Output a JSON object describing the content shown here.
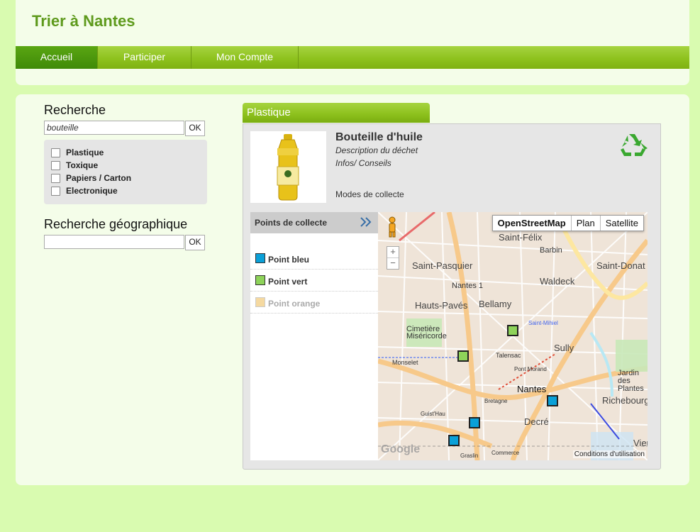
{
  "header": {
    "title": "Trier à Nantes",
    "nav": [
      "Accueil",
      "Participer",
      "Mon Compte"
    ]
  },
  "search": {
    "heading": "Recherche",
    "value": "bouteille",
    "ok_label": "OK",
    "filters": [
      "Plastique",
      "Toxique",
      "Papiers / Carton",
      "Electronique"
    ]
  },
  "geo_search": {
    "heading": "Recherche géographique",
    "value": "",
    "ok_label": "OK"
  },
  "category": {
    "label": "Plastique"
  },
  "product": {
    "title": "Bouteille d'huile",
    "description": "Description du déchet",
    "tips": "Infos/ Conseils",
    "modes": "Modes de collecte"
  },
  "points": {
    "header": "Points de collecte",
    "items": [
      {
        "label": "Point bleu",
        "color": "#0aa0d8"
      },
      {
        "label": "Point vert",
        "color": "#8ed35a"
      },
      {
        "label": "Point orange",
        "color": "#f5d9a0"
      }
    ]
  },
  "map": {
    "types": [
      "OpenStreetMap",
      "Plan",
      "Satellite"
    ],
    "zoom_in": "+",
    "zoom_out": "−",
    "terms": "Conditions d'utilisation",
    "logo": "Google",
    "labels": [
      "Saint-Félix",
      "Barbin",
      "Saint-Pasquier",
      "Saint-Donat",
      "Nantes 1",
      "Waldeck",
      "Hauts-Pavés",
      "Bellamy",
      "Cimetière Miséricorde",
      "Saint-Mihiel",
      "Sully",
      "Talensac",
      "Monselet",
      "Pont Morand",
      "Jardin des Plantes",
      "Nantes",
      "Richebourg",
      "Bretagne",
      "Guist'Hau",
      "Decré",
      "Commerce",
      "Graslin",
      "Vieux"
    ]
  }
}
